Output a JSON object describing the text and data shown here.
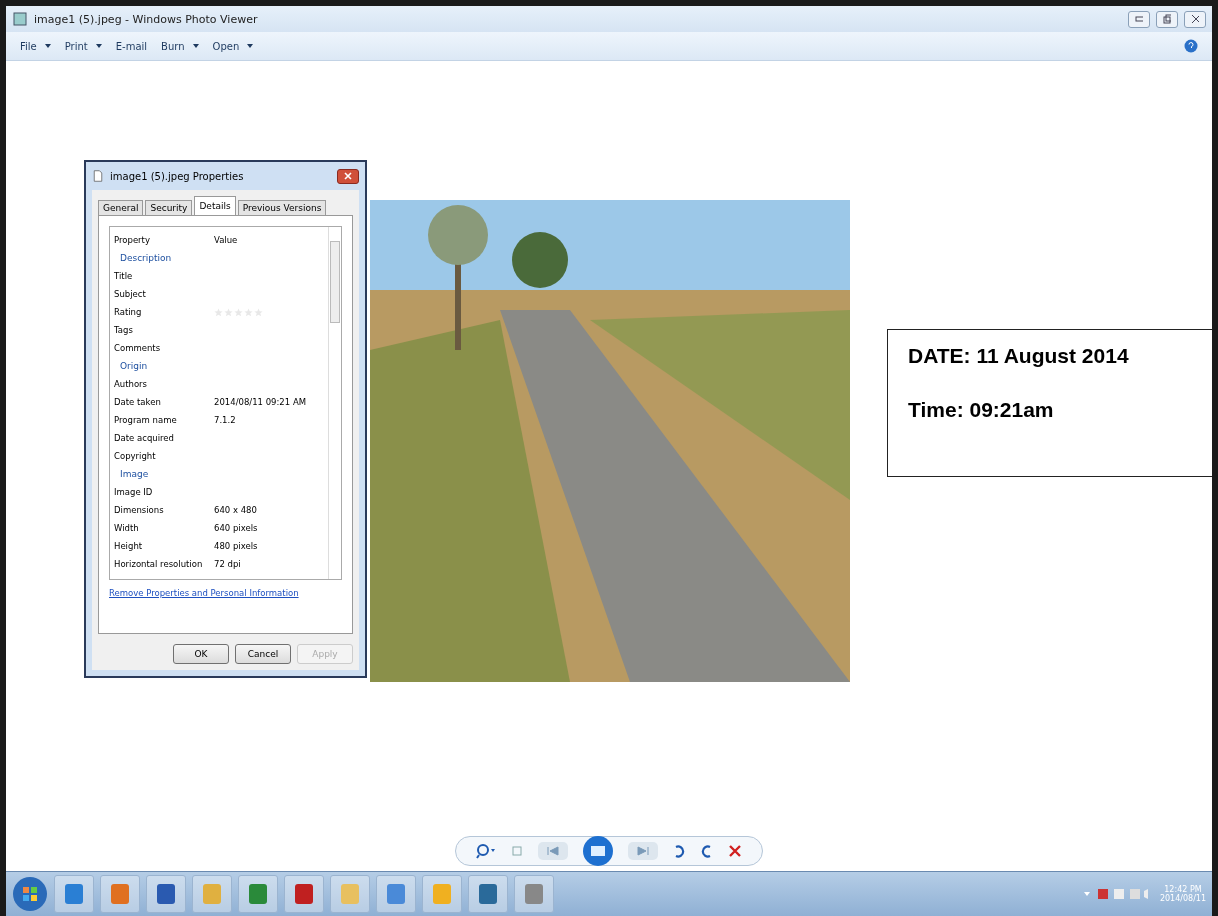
{
  "window": {
    "title": "image1 (5).jpeg - Windows Photo Viewer"
  },
  "menu": [
    {
      "label": "File",
      "dropdown": true
    },
    {
      "label": "Print",
      "dropdown": true
    },
    {
      "label": "E-mail",
      "dropdown": false
    },
    {
      "label": "Burn",
      "dropdown": true
    },
    {
      "label": "Open",
      "dropdown": true
    }
  ],
  "dialog": {
    "title": "image1 (5).jpeg Properties",
    "tabs": [
      {
        "label": "General",
        "selected": false
      },
      {
        "label": "Security",
        "selected": false
      },
      {
        "label": "Details",
        "selected": true
      },
      {
        "label": "Previous Versions",
        "selected": false
      }
    ],
    "columns": [
      "Property",
      "Value"
    ],
    "rows": [
      {
        "kind": "group",
        "label": "Description"
      },
      {
        "kind": "row",
        "label": "Title"
      },
      {
        "kind": "row",
        "label": "Subject"
      },
      {
        "kind": "rating",
        "label": "Rating",
        "stars": 0
      },
      {
        "kind": "row",
        "label": "Tags"
      },
      {
        "kind": "row",
        "label": "Comments"
      },
      {
        "kind": "group",
        "label": "Origin"
      },
      {
        "kind": "row",
        "label": "Authors"
      },
      {
        "kind": "row",
        "label": "Date taken",
        "value": "2014/08/11 09:21 AM"
      },
      {
        "kind": "row",
        "label": "Program name",
        "value": "7.1.2"
      },
      {
        "kind": "row",
        "label": "Date acquired"
      },
      {
        "kind": "row",
        "label": "Copyright"
      },
      {
        "kind": "group",
        "label": "Image"
      },
      {
        "kind": "row",
        "label": "Image ID"
      },
      {
        "kind": "row",
        "label": "Dimensions",
        "value": "640 x 480"
      },
      {
        "kind": "row",
        "label": "Width",
        "value": "640 pixels"
      },
      {
        "kind": "row",
        "label": "Height",
        "value": "480 pixels"
      },
      {
        "kind": "row",
        "label": "Horizontal resolution",
        "value": "72 dpi"
      }
    ],
    "link": "Remove Properties and Personal Information",
    "buttons": [
      {
        "label": "OK",
        "disabled": false
      },
      {
        "label": "Cancel",
        "disabled": false
      },
      {
        "label": "Apply",
        "disabled": true
      }
    ]
  },
  "note": [
    "DATE: 11 August 2014",
    "Time: 09:21am"
  ],
  "clock": {
    "time": "12:42 PM",
    "date": "2014/08/11"
  }
}
